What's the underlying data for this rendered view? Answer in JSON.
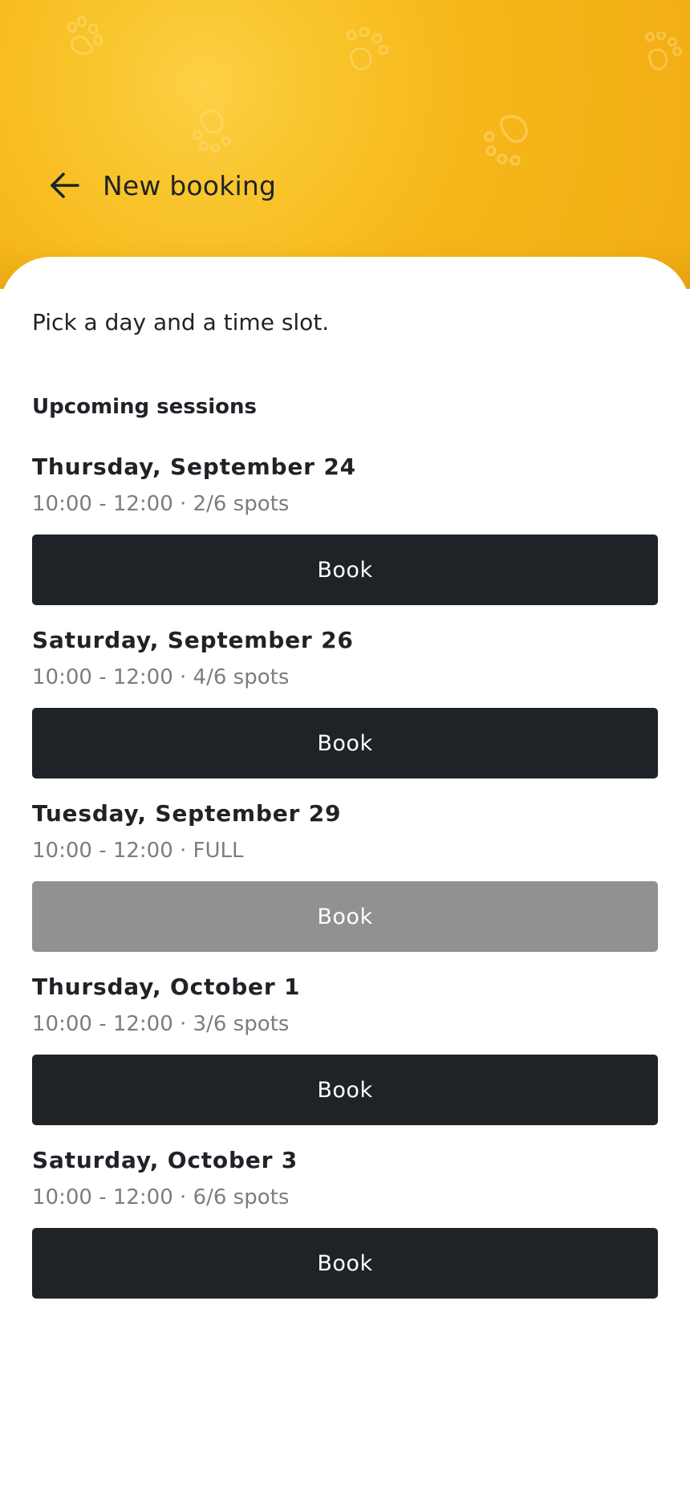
{
  "header": {
    "title": "New booking",
    "back_icon": "arrow-left-icon",
    "background_color": "#F6B71A",
    "decoration_icon": "paw-print-icon"
  },
  "intro_text": "Pick a day and a time slot.",
  "section_title": "Upcoming sessions",
  "sessions": [
    {
      "date": "Thursday, September 24",
      "info": "10:00 - 12:00 · 2/6 spots",
      "button_label": "Book",
      "available": true
    },
    {
      "date": "Saturday, September 26",
      "info": "10:00 - 12:00 · 4/6 spots",
      "button_label": "Book",
      "available": true
    },
    {
      "date": "Tuesday, September 29",
      "info": "10:00 - 12:00 · FULL",
      "button_label": "Book",
      "available": false
    },
    {
      "date": "Thursday, October 1",
      "info": "10:00 - 12:00 · 3/6 spots",
      "button_label": "Book",
      "available": true
    },
    {
      "date": "Saturday, October 3",
      "info": "10:00 - 12:00 · 6/6 spots",
      "button_label": "Book",
      "available": true
    }
  ],
  "colors": {
    "button_active": "#1F2327",
    "button_disabled": "#909192",
    "text_primary": "#1F2327",
    "text_secondary": "#7B7D80"
  }
}
